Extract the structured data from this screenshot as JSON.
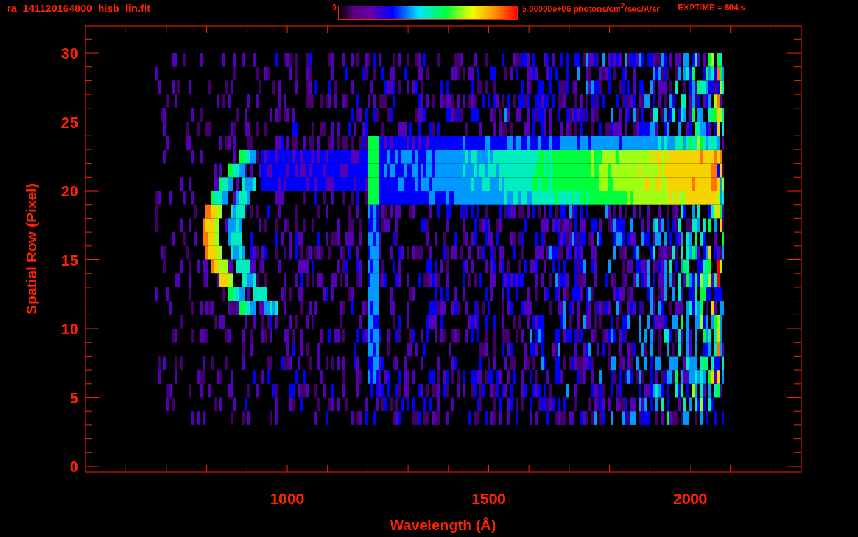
{
  "header": {
    "title": "ra_141120164800_hisb_lin.fit",
    "colorbar": {
      "min_label": "0",
      "max_label": "5.00000e+06 photons/cm$^{2}$/sec/A/sr"
    },
    "exposure": "EXPTIME = 604 s"
  },
  "plot": {
    "x_axis": {
      "title": "Wavelength (Å)",
      "ticks": [
        "1000",
        "1500",
        "2000"
      ]
    },
    "y_axis": {
      "title": "Spatial Row (Pixel)",
      "ticks": [
        "30",
        "25",
        "20",
        "15",
        "10",
        "5",
        "0"
      ]
    }
  }
}
